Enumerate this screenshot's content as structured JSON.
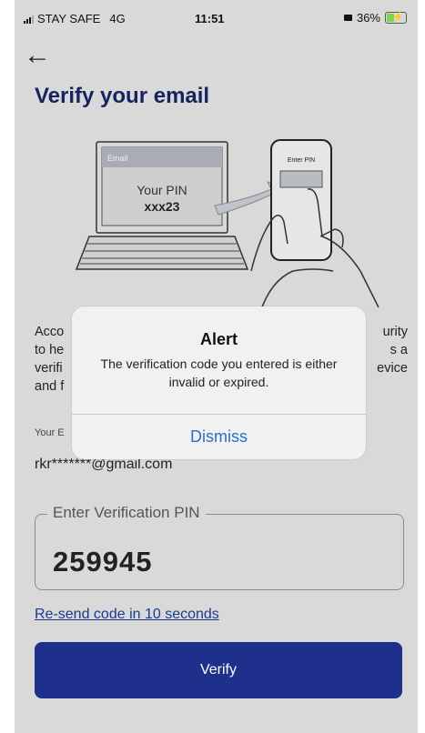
{
  "status_bar": {
    "carrier": "STAY SAFE",
    "network": "4G",
    "time": "11:51",
    "battery": "36%",
    "battery_level": 0.36
  },
  "header": {
    "back_icon": "arrow-left-icon",
    "title": "Verify your email"
  },
  "illustration": {
    "screen_label": "Email",
    "pin_caption": "Your PIN",
    "pin_code": "xxx23",
    "phone_label": "Enter PIN"
  },
  "body": {
    "lines": [
      "Acco",
      "to he",
      "verifi",
      "and f"
    ],
    "right_lines": [
      "urity",
      "s a",
      "evice"
    ]
  },
  "email": {
    "label": "Your E",
    "value": "rkr*******@gmail.com"
  },
  "pin_field": {
    "label": "Enter Verification PIN",
    "value": "259945"
  },
  "resend": {
    "text": "Re-send code in 10 seconds"
  },
  "verify_button": {
    "label": "Verify"
  },
  "alert": {
    "title": "Alert",
    "message": "The verification code you entered is either invalid or expired.",
    "button": "Dismiss"
  },
  "colors": {
    "primary": "#1f2f8c",
    "title": "#17235e",
    "link": "#2a6fc9",
    "battery": "#7ad64a"
  }
}
